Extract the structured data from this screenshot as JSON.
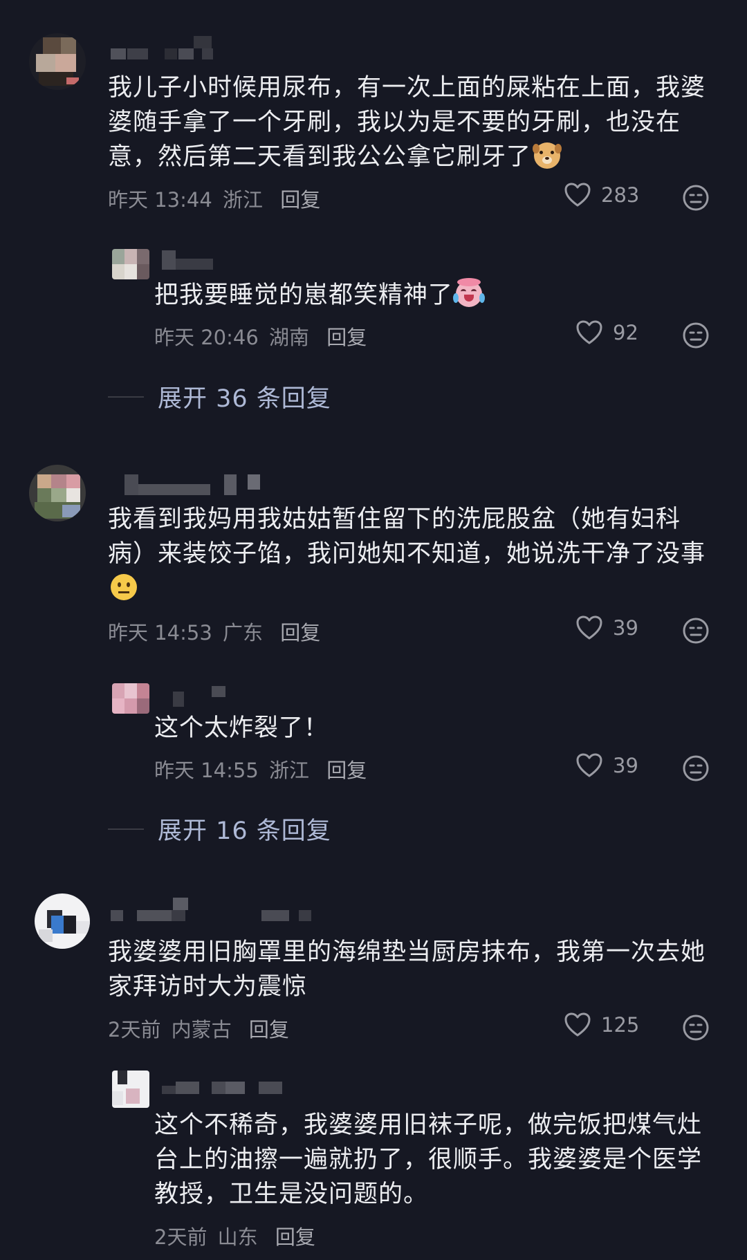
{
  "comments": [
    {
      "text": "我儿子小时候用尿布，有一次上面的屎粘在上面，我婆婆随手拿了一个牙刷，我以为是不要的牙刷，也没在意，然后第二天看到我公公拿它刷牙了",
      "emoji": "dog-face-emoji",
      "time": "昨天 13:44",
      "location": "浙江",
      "reply_label": "回复",
      "likes": "283",
      "replies": [
        {
          "text": "把我要睡觉的崽都笑精神了",
          "emoji": "laughing-crying-emoji",
          "time": "昨天 20:46",
          "location": "湖南",
          "reply_label": "回复",
          "likes": "92"
        }
      ],
      "expand_label": "展开 36 条回复"
    },
    {
      "text": "我看到我妈用我姑姑暂住留下的洗屁股盆（她有妇科病）来装饺子馅，我问她知不知道，她说洗干净了没事",
      "emoji": "neutral-face-emoji",
      "time": "昨天 14:53",
      "location": "广东",
      "reply_label": "回复",
      "likes": "39",
      "replies": [
        {
          "text": "这个太炸裂了！",
          "time": "昨天 14:55",
          "location": "浙江",
          "reply_label": "回复",
          "likes": "39"
        }
      ],
      "expand_label": "展开 16 条回复"
    },
    {
      "text": "我婆婆用旧胸罩里的海绵垫当厨房抹布，我第一次去她家拜访时大为震惊",
      "time": "2天前",
      "location": "内蒙古",
      "reply_label": "回复",
      "likes": "125",
      "replies": [
        {
          "text": "这个不稀奇，我婆婆用旧袜子呢，做完饭把煤气灶台上的油擦一遍就扔了，很顺手。我婆婆是个医学教授，卫生是没问题的。",
          "time": "2天前",
          "location": "山东",
          "reply_label": "回复"
        }
      ]
    }
  ],
  "icons": {
    "like": "heart-outline-icon",
    "dislike": "meh-face-icon"
  },
  "colors": {
    "background": "#161823",
    "text": "#ecedf0",
    "meta": "#8a8b93",
    "expand": "#aeb9d6"
  }
}
